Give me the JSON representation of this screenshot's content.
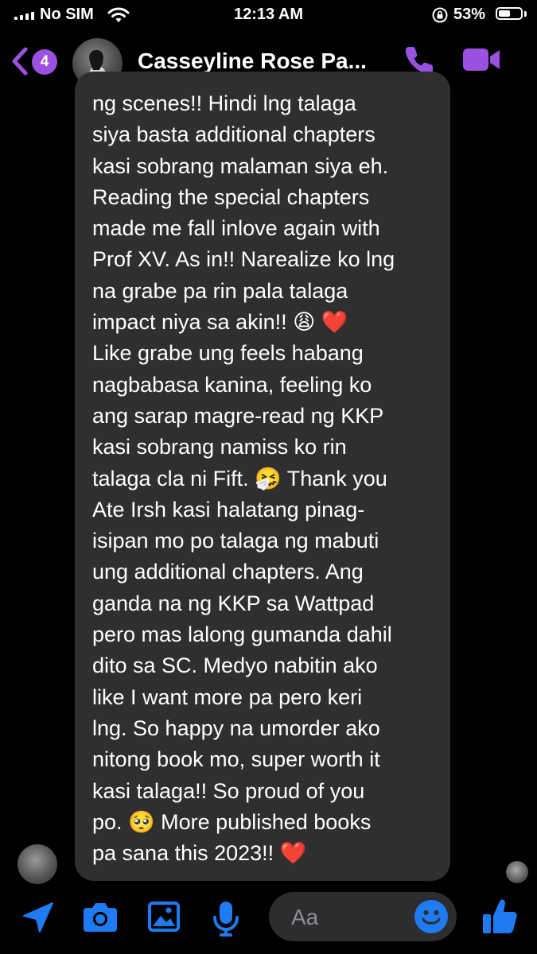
{
  "status_bar": {
    "carrier": "No SIM",
    "time": "12:13 AM",
    "battery_percent": "53%",
    "battery_level": 0.53
  },
  "header": {
    "unread_count": "4",
    "contact_name": "Casseyline Rose Pa..."
  },
  "message": {
    "text": "ng scenes!! Hindi lng talaga\nsiya basta additional chapters\nkasi sobrang malaman siya eh.\nReading the special chapters\nmade me fall inlove again with\nProf XV. As in!! Narealize ko lng\nna grabe pa rin pala talaga\nimpact niya sa akin!! 😩 ❤️\nLike grabe ung feels habang\nnagbabasa kanina, feeling ko\nang sarap magre-read ng KKP\nkasi sobrang namiss ko rin\ntalaga cla ni Fift. 🤧  Thank you\nAte Irsh kasi halatang pinag-\nisipan mo po talaga ng mabuti\nung additional chapters. Ang\nganda na ng KKP sa Wattpad\npero mas lalong gumanda dahil\ndito sa SC. Medyo nabitin ako\nlike I want more pa pero keri\nlng.   So happy na umorder ako\nnitong book mo, super worth it\nkasi talaga!! So proud of you\npo. 🥺  More published books\npa sana this 2023!! ❤️"
  },
  "composer": {
    "placeholder": "Aa"
  },
  "colors": {
    "accent": "#9b51e0",
    "bubble": "#2f2f30",
    "toolbar_blue": "#1e7bf2"
  },
  "icons": {
    "back": "chevron-left-icon",
    "call": "phone-icon",
    "video": "video-camera-icon",
    "location": "location-arrow-icon",
    "camera": "camera-icon",
    "gallery": "image-icon",
    "mic": "microphone-icon",
    "emoji": "smiley-icon",
    "like": "thumbs-up-icon"
  }
}
